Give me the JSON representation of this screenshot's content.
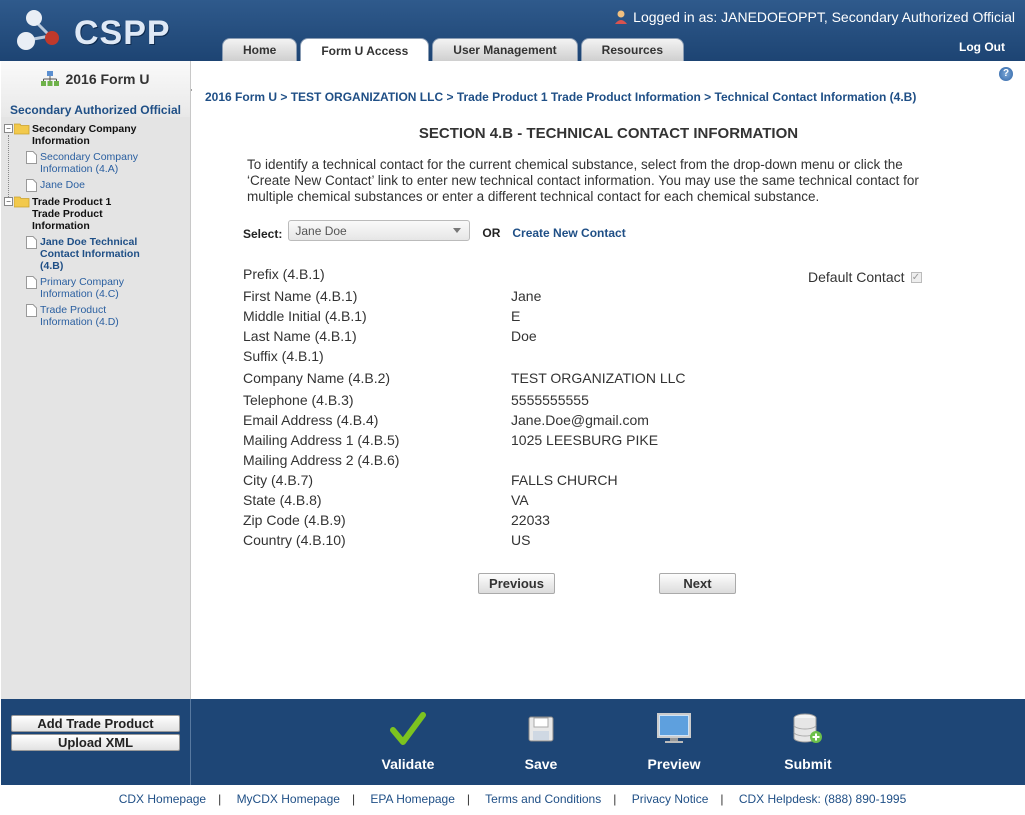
{
  "header": {
    "logo_text": "CSPP",
    "logged_in_text": "Logged in as: JANEDOEOPPT, Secondary Authorized Official",
    "tabs": [
      "Home",
      "Form U Access",
      "User Management",
      "Resources"
    ],
    "active_tab": "Form U Access",
    "logout_label": "Log Out"
  },
  "sidebar": {
    "title": "2016 Form U",
    "role": "Secondary Authorized Official",
    "tree": {
      "group1": {
        "label": "Secondary Company Information",
        "children": [
          "Secondary Company Information (4.A)",
          "Jane Doe"
        ]
      },
      "group2": {
        "label": "Trade Product 1 Trade Product Information",
        "children": [
          "Jane Doe Technical Contact Information (4.B)",
          "Primary Company Information (4.C)",
          "Trade Product Information (4.D)"
        ]
      }
    }
  },
  "main": {
    "breadcrumb": "2016 Form U > TEST ORGANIZATION LLC > Trade Product 1 Trade Product Information > Technical Contact Information (4.B)",
    "section_title": "SECTION 4.B - TECHNICAL CONTACT INFORMATION",
    "instructions": "To identify a technical contact for the current chemical substance, select from the drop-down menu or click the ‘Create New Contact’ link to enter new technical contact information. You may use the same technical contact for multiple chemical substances or enter a different technical contact for each chemical substance.",
    "select_label": "Select:",
    "select_value": "Jane Doe",
    "or_label": "OR",
    "create_link": "Create New Contact",
    "default_contact_label": "Default Contact",
    "default_contact_checked": true,
    "fields": [
      {
        "label": "Prefix (4.B.1)",
        "value": ""
      },
      {
        "label": "First Name (4.B.1)",
        "value": "Jane"
      },
      {
        "label": "Middle Initial (4.B.1)",
        "value": "E"
      },
      {
        "label": "Last Name (4.B.1)",
        "value": "Doe"
      },
      {
        "label": "Suffix (4.B.1)",
        "value": ""
      },
      {
        "label": "Company Name (4.B.2)",
        "value": "TEST ORGANIZATION LLC"
      },
      {
        "label": "Telephone (4.B.3)",
        "value": "5555555555"
      },
      {
        "label": "Email Address (4.B.4)",
        "value": "Jane.Doe@gmail.com"
      },
      {
        "label": "Mailing Address 1 (4.B.5)",
        "value": "1025 LEESBURG PIKE"
      },
      {
        "label": "Mailing Address 2 (4.B.6)",
        "value": ""
      },
      {
        "label": "City (4.B.7)",
        "value": "FALLS CHURCH"
      },
      {
        "label": "State (4.B.8)",
        "value": "VA"
      },
      {
        "label": "Zip Code (4.B.9)",
        "value": "22033"
      },
      {
        "label": "Country (4.B.10)",
        "value": "US"
      }
    ],
    "previous_label": "Previous",
    "next_label": "Next"
  },
  "toolbar": {
    "add_trade_product": "Add Trade Product",
    "upload_xml": "Upload XML",
    "actions": [
      "Validate",
      "Save",
      "Preview",
      "Submit"
    ]
  },
  "footer": {
    "links": [
      "CDX Homepage",
      "MyCDX Homepage",
      "EPA Homepage",
      "Terms and Conditions",
      "Privacy Notice",
      "CDX Helpdesk: (888) 890-1995"
    ]
  },
  "colors": {
    "header_blue": "#1d4473",
    "link_blue": "#1f4f86",
    "toolbar_blue": "#1e4676",
    "validate_green": "#7cc320"
  }
}
